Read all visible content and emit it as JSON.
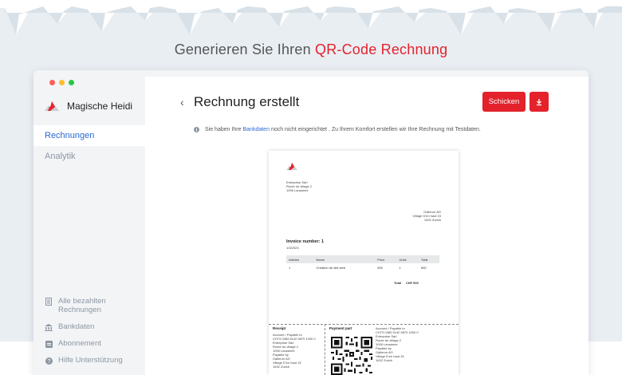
{
  "headline": {
    "prefix": "Generieren Sie Ihren",
    "accent": "QR-Code",
    "suffix": "Rechnung"
  },
  "colors": {
    "accent": "#e3222c",
    "link": "#2a6bd1",
    "sidebar_bg": "#f2f4f6",
    "dot_red": "#fe5f57",
    "dot_yellow": "#febc2e",
    "dot_green": "#28c840"
  },
  "sidebar": {
    "brand": "Magische Heidi",
    "nav": [
      {
        "label": "Rechnungen",
        "active": true
      },
      {
        "label": "Analytik",
        "active": false
      }
    ],
    "bottom_links": [
      {
        "icon": "document-icon",
        "line1": "Alle bezahlten",
        "line2": "Rechnungen"
      },
      {
        "icon": "bank-icon",
        "line1": "Bankdaten"
      },
      {
        "icon": "subscription-icon",
        "line1": "Abonnement"
      },
      {
        "icon": "help-icon",
        "line1": "Hilfe Unterstützung"
      }
    ]
  },
  "main": {
    "back_glyph": "‹",
    "title": "Rechnung erstellt",
    "send_label": "Schicken",
    "download_icon": "download-icon",
    "info": {
      "before": "Sie haben Ihre",
      "link": "Bankdaten",
      "after": "noch nicht eingerichtet . Zu Ihrem Komfort erstellen wir Ihre Rechnung mit Testdaten."
    }
  },
  "invoice": {
    "sender": [
      "Entreprise Sàrl",
      "Route du village 2",
      "1006 Lausanne"
    ],
    "recipient": [
      "Gallerun AG",
      "Village D'en haut 15",
      "1632 Zurich"
    ],
    "number_label": "Invoice number: 1",
    "date": "1/3/2023",
    "columns": [
      "Articles",
      "Name",
      "Price",
      "Units",
      "Total"
    ],
    "rows": [
      [
        "1",
        "Création de site web",
        "500",
        "1",
        "500"
      ]
    ],
    "total_label": "Total",
    "total_value": "CHF 500",
    "receipt_title": "Receipt",
    "receipt_lines": [
      "Account / Payable to",
      "CH73 0483 5142 5879 1000 0",
      "Entreprise Sàrl",
      "Route du village 2",
      "1006 Lausanne",
      "Payable by",
      "Gallerun AG",
      "Village D'en haut 15",
      "1632 Zurich"
    ],
    "payment_title": "Payment part",
    "account_lines": [
      "Account / Payable to",
      "CH73 0483 5142 5879 1000 0",
      "Entreprise Sàrl",
      "Route du village 2",
      "1006 Lausanne",
      "Payable by",
      "Gallerun AG",
      "Village D'en haut 15",
      "1632 Zurich"
    ]
  }
}
